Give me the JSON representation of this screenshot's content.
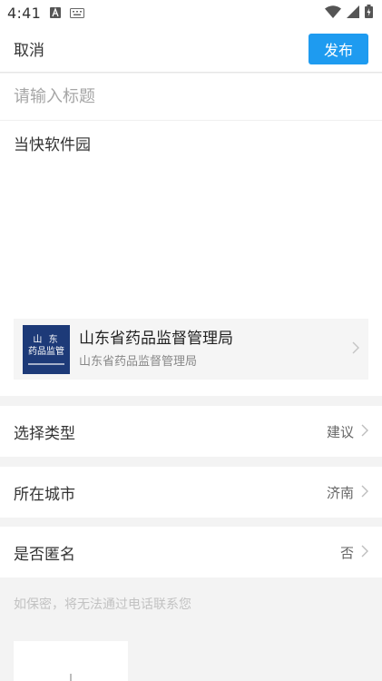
{
  "status_bar": {
    "time": "4:41",
    "icons": [
      "a-icon",
      "keyboard-icon",
      "wifi-icon",
      "signal-icon",
      "battery-icon"
    ]
  },
  "nav": {
    "cancel_label": "取消",
    "publish_label": "发布"
  },
  "editor": {
    "title_placeholder": "请输入标题",
    "content": "当快软件园"
  },
  "org_card": {
    "logo_line1": "山 东",
    "logo_line2": "药品监管",
    "name": "山东省药品监督管理局",
    "subtitle": "山东省药品监督管理局"
  },
  "rows": {
    "type": {
      "label": "选择类型",
      "value": "建议"
    },
    "city": {
      "label": "所在城市",
      "value": "济南"
    },
    "anonymous": {
      "label": "是否匿名",
      "value": "否"
    }
  },
  "hint": "如保密，将无法通过电话联系您",
  "colors": {
    "accent": "#1e9bf0",
    "page_bg": "#f3f3f3",
    "logo_bg": "#1d3a78"
  }
}
